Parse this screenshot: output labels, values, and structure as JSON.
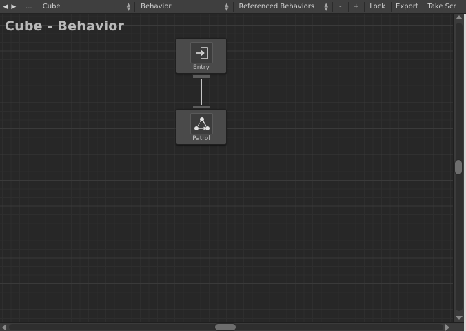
{
  "toolbar": {
    "back_glyph": "◀",
    "forward_glyph": "▶",
    "more_label": "...",
    "object_dropdown": "Cube",
    "behavior_dropdown": "Behavior",
    "referenced_dropdown": "Referenced Behaviors",
    "zoom_out_label": "-",
    "zoom_in_label": "+",
    "lock_label": "Lock",
    "export_label": "Export",
    "screenshot_label": "Take Scr"
  },
  "graph": {
    "title": "Cube - Behavior",
    "nodes": [
      {
        "label": "Entry",
        "icon": "entry-icon"
      },
      {
        "label": "Patrol",
        "icon": "patrol-icon"
      }
    ]
  },
  "colors": {
    "background": "#272727",
    "toolbar": "#3f3f3f",
    "node": "#4a4a4a",
    "link": "#c6c6c6"
  }
}
